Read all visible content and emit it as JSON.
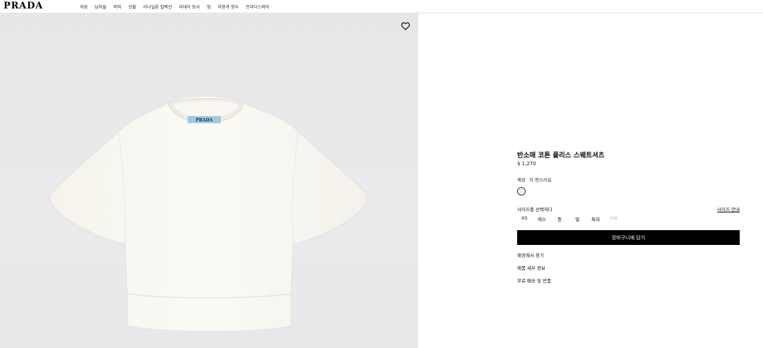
{
  "header": {
    "logo": "PRADA",
    "nav": [
      "여성",
      "남자들",
      "버지",
      "선물",
      "리나일론 컬렉션",
      "리데아 토사",
      "집",
      "미용과 향수",
      "프라다스피어"
    ]
  },
  "product": {
    "title": "반소매 코튼 플리스 스웨트셔츠",
    "price": "$ 1,270",
    "color_label": "색상",
    "color_value": "지 엔스러운",
    "swatch_color": "#f1ebe3",
    "size_label": "사이즈를 선택하다",
    "size_guide": "사이즈 안내",
    "sizes": [
      {
        "label": "XS",
        "available": true
      },
      {
        "label": "에스",
        "available": true
      },
      {
        "label": "중",
        "available": true
      },
      {
        "label": "엘",
        "available": true
      },
      {
        "label": "특대",
        "available": true
      },
      {
        "label": "XXL",
        "available": false
      }
    ],
    "add_to_cart": "장바구니에 담기",
    "links": [
      "매장에서 찾기",
      "제품 세부 정보",
      "무료 배송 및 반품"
    ]
  },
  "image": {
    "label_text": "PRADA",
    "icons": {
      "favorite": "heart-icon"
    }
  }
}
